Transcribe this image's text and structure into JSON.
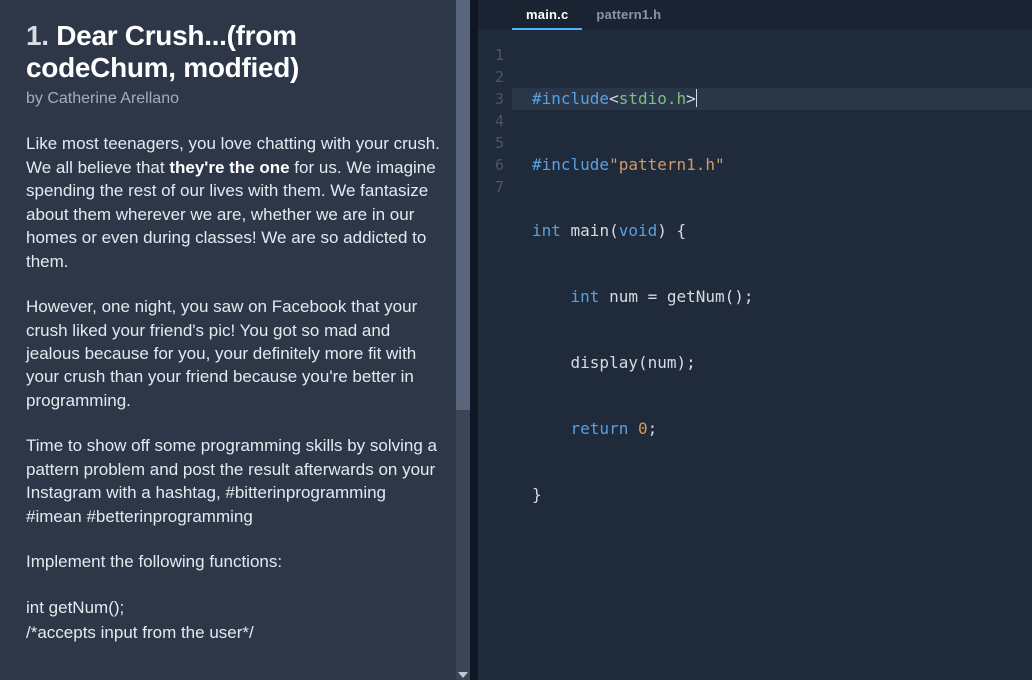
{
  "problem": {
    "number": "1.",
    "title": "Dear Crush...(from codeChum, modfied)",
    "author": "by Catherine Arellano",
    "para1_a": "Like most teenagers, you love chatting with your crush. We all believe that ",
    "para1_bold": "they're the one",
    "para1_b": " for us. We imagine spending the rest of our lives with them. We fantasize about them wherever we are, whether we are in our homes or even during classes! We are so addicted to them.",
    "para2": "However, one night, you saw on Facebook that your crush liked your friend's pic! You got so mad and jealous because for you, your definitely more fit with your crush than your friend because you're better in programming.",
    "para3": "Time to show off some programming skills by solving a pattern problem and post the result afterwards on your Instagram with a hashtag, #bitterinprogramming #imean #betterinprogramming",
    "para4": "Implement the following functions:",
    "para5": "int getNum();",
    "para6": "/*accepts input from the user*/"
  },
  "tabs": {
    "t0": "main.c",
    "t1": "pattern1.h"
  },
  "code": {
    "l1_include": "#include",
    "l1_lt": "<",
    "l1_hdr": "stdio.h",
    "l1_gt": ">",
    "l2_include": "#include",
    "l2_str": "\"pattern1.h\"",
    "l3_int": "int",
    "l3_main": " main(",
    "l3_void": "void",
    "l3_rest": ") {",
    "l4_indent": "    ",
    "l4_int": "int",
    "l4_rest1": " num = getNum();",
    "l5_indent": "    ",
    "l5_rest": "display(num);",
    "l6_indent": "    ",
    "l6_return": "return",
    "l6_sp": " ",
    "l6_zero": "0",
    "l6_semi": ";",
    "l7": "}"
  },
  "linenums": {
    "n1": "1",
    "n2": "2",
    "n3": "3",
    "n4": "4",
    "n5": "5",
    "n6": "6",
    "n7": "7"
  }
}
